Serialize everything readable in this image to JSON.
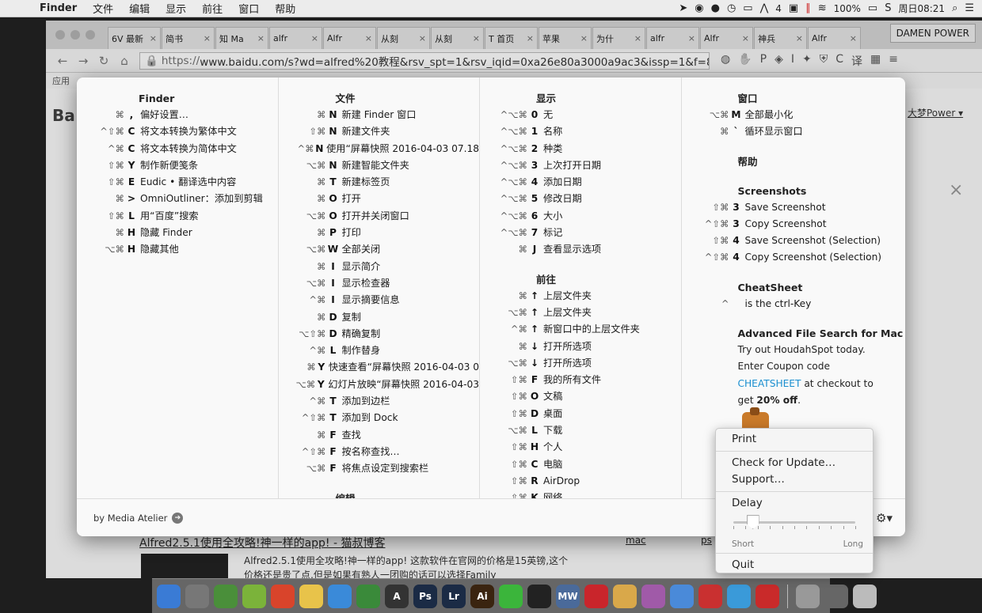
{
  "menubar": {
    "apple": "",
    "app_name": "Finder",
    "menus": [
      "文件",
      "编辑",
      "显示",
      "前往",
      "窗口",
      "帮助"
    ],
    "status": {
      "alfred_badge": "4",
      "battery": "100%",
      "datetime": "周日08:21"
    }
  },
  "browser": {
    "tabs": [
      {
        "label": "6V 最新"
      },
      {
        "label": "简书"
      },
      {
        "label": "知 Ma"
      },
      {
        "label": "alfr"
      },
      {
        "label": "Alfr"
      },
      {
        "label": "从刻"
      },
      {
        "label": "从刻"
      },
      {
        "label": "T 首页"
      },
      {
        "label": "苹果"
      },
      {
        "label": "为什"
      },
      {
        "label": "alfr"
      },
      {
        "label": "Alfr"
      },
      {
        "label": "神兵"
      },
      {
        "label": "Alfr"
      }
    ],
    "profile": "DAMEN POWER",
    "url_scheme": "https://",
    "url_rest": "www.baidu.com/s?wd=alfred%20教程&rsv_spt=1&rsv_iqid=0xa26e80a3000a9ac3&issp=1&f=8...",
    "bookmark_first": "应用",
    "logo": "Ba",
    "user": "大梦Power ▾",
    "result_title_em": "Alfred",
    "result_title_rest": "2.5.1使用全攻略!神一样的app! - 猫叔博客",
    "result_snippet_em": "Alfred",
    "result_snippet_rest": "2.5.1使用全攻略!神一样的app! 这款软件在官网的价格是15英镑,这个价格还是贵了点,但是如果有熟人一团购的话可以选择Family",
    "side_links": [
      "mac",
      "ps"
    ]
  },
  "cheatsheet": {
    "columns": [
      {
        "sections": [
          {
            "title": "Finder",
            "rows": [
              {
                "mods": "⌘",
                "key": ",",
                "label": "偏好设置…"
              },
              {
                "mods": "^⇧⌘",
                "key": "C",
                "label": "将文本转换为繁体中文"
              },
              {
                "mods": "^⌘",
                "key": "C",
                "label": "将文本转换为简体中文"
              },
              {
                "mods": "⇧⌘",
                "key": "Y",
                "label": "制作新便笺条"
              },
              {
                "mods": "⇧⌘",
                "key": "E",
                "label": "Eudic • 翻译选中内容"
              },
              {
                "mods": "⌘",
                "key": ">",
                "label": "OmniOutliner：添加到剪辑"
              },
              {
                "mods": "⇧⌘",
                "key": "L",
                "label": "用“百度”搜索"
              },
              {
                "mods": "⌘",
                "key": "H",
                "label": "隐藏 Finder"
              },
              {
                "mods": "⌥⌘",
                "key": "H",
                "label": "隐藏其他"
              }
            ]
          }
        ]
      },
      {
        "sections": [
          {
            "title": "文件",
            "rows": [
              {
                "mods": "⌘",
                "key": "N",
                "label": "新建 Finder 窗口"
              },
              {
                "mods": "⇧⌘",
                "key": "N",
                "label": "新建文件夹"
              },
              {
                "mods": "^⌘",
                "key": "N",
                "label": "使用“屏幕快照 2016-04-03 07.18"
              },
              {
                "mods": "⌥⌘",
                "key": "N",
                "label": "新建智能文件夹"
              },
              {
                "mods": "⌘",
                "key": "T",
                "label": "新建标签页"
              },
              {
                "mods": "⌘",
                "key": "O",
                "label": "打开"
              },
              {
                "mods": "⌥⌘",
                "key": "O",
                "label": "打开并关闭窗口"
              },
              {
                "mods": "⌘",
                "key": "P",
                "label": "打印"
              },
              {
                "mods": "⌥⌘",
                "key": "W",
                "label": "全部关闭"
              },
              {
                "mods": "⌘",
                "key": "I",
                "label": "显示简介"
              },
              {
                "mods": "⌥⌘",
                "key": "I",
                "label": "显示检查器"
              },
              {
                "mods": "^⌘",
                "key": "I",
                "label": "显示摘要信息"
              },
              {
                "mods": "⌘",
                "key": "D",
                "label": "复制"
              },
              {
                "mods": "⌥⇧⌘",
                "key": "D",
                "label": "精确复制"
              },
              {
                "mods": "^⌘",
                "key": "L",
                "label": "制作替身"
              },
              {
                "mods": "⌘",
                "key": "Y",
                "label": "快速查看“屏幕快照 2016-04-03 0"
              },
              {
                "mods": "⌥⌘",
                "key": "Y",
                "label": "幻灯片放映“屏幕快照 2016-04-03"
              },
              {
                "mods": "^⌘",
                "key": "T",
                "label": "添加到边栏"
              },
              {
                "mods": "^⇧⌘",
                "key": "T",
                "label": "添加到 Dock"
              },
              {
                "mods": "⌘",
                "key": "F",
                "label": "查找"
              },
              {
                "mods": "^⇧⌘",
                "key": "F",
                "label": "按名称查找…"
              },
              {
                "mods": "⌥⌘",
                "key": "F",
                "label": "将焦点设定到搜索栏"
              }
            ]
          },
          {
            "title": "编辑",
            "rows": []
          }
        ]
      },
      {
        "sections": [
          {
            "title": "显示",
            "rows": [
              {
                "mods": "^⌥⌘",
                "key": "0",
                "label": "无"
              },
              {
                "mods": "^⌥⌘",
                "key": "1",
                "label": "名称"
              },
              {
                "mods": "^⌥⌘",
                "key": "2",
                "label": "种类"
              },
              {
                "mods": "^⌥⌘",
                "key": "3",
                "label": "上次打开日期"
              },
              {
                "mods": "^⌥⌘",
                "key": "4",
                "label": "添加日期"
              },
              {
                "mods": "^⌥⌘",
                "key": "5",
                "label": "修改日期"
              },
              {
                "mods": "^⌥⌘",
                "key": "6",
                "label": "大小"
              },
              {
                "mods": "^⌥⌘",
                "key": "7",
                "label": "标记"
              },
              {
                "mods": "⌘",
                "key": "J",
                "label": "查看显示选项"
              }
            ]
          },
          {
            "title": "前往",
            "rows": [
              {
                "mods": "⌘",
                "key": "↑",
                "label": "上层文件夹"
              },
              {
                "mods": "⌥⌘",
                "key": "↑",
                "label": "上层文件夹"
              },
              {
                "mods": "^⌘",
                "key": "↑",
                "label": "新窗口中的上层文件夹"
              },
              {
                "mods": "⌘",
                "key": "↓",
                "label": "打开所选项"
              },
              {
                "mods": "⌥⌘",
                "key": "↓",
                "label": "打开所选项"
              },
              {
                "mods": "⇧⌘",
                "key": "F",
                "label": "我的所有文件"
              },
              {
                "mods": "⇧⌘",
                "key": "O",
                "label": "文稿"
              },
              {
                "mods": "⇧⌘",
                "key": "D",
                "label": "桌面"
              },
              {
                "mods": "⌥⌘",
                "key": "L",
                "label": "下载"
              },
              {
                "mods": "⇧⌘",
                "key": "H",
                "label": "个人"
              },
              {
                "mods": "⇧⌘",
                "key": "C",
                "label": "电脑"
              },
              {
                "mods": "⇧⌘",
                "key": "R",
                "label": "AirDrop"
              },
              {
                "mods": "⇧⌘",
                "key": "K",
                "label": "网络"
              }
            ]
          }
        ]
      },
      {
        "sections": [
          {
            "title": "窗口",
            "rows": [
              {
                "mods": "⌥⌘",
                "key": "M",
                "label": "全部最小化"
              },
              {
                "mods": "⌘",
                "key": "`",
                "label": "循环显示窗口"
              }
            ]
          },
          {
            "title": "帮助",
            "rows": []
          },
          {
            "title": "Screenshots",
            "rows": [
              {
                "mods": "⇧⌘",
                "key": "3",
                "label": "Save Screenshot"
              },
              {
                "mods": "^⇧⌘",
                "key": "3",
                "label": "Copy Screenshot"
              },
              {
                "mods": "⇧⌘",
                "key": "4",
                "label": "Save Screenshot (Selection)"
              },
              {
                "mods": "^⇧⌘",
                "key": "4",
                "label": "Copy Screenshot (Selection)"
              }
            ]
          },
          {
            "title": "CheatSheet",
            "rows": [
              {
                "mods": "^",
                "key": "",
                "label": "is the ctrl-Key"
              }
            ]
          }
        ]
      }
    ],
    "ad": {
      "title": "Advanced File Search for Mac",
      "line1": "Try out HoudahSpot today.",
      "line2": "Enter Coupon code",
      "coupon": "CHEATSHEET",
      "line3_rest": " at checkout to",
      "line4_pre": "get ",
      "line4_bold": "20% off",
      "line4_post": "."
    },
    "footer": "by Media Atelier",
    "icons": {
      "footer_arrow": "arrow-right-circle-icon",
      "gear": "gear-icon"
    }
  },
  "popup": {
    "print": "Print",
    "check_update": "Check for Update…",
    "support": "Support…",
    "delay_label": "Delay",
    "delay_value": 0.16,
    "delay_min_label": "Short",
    "delay_max_label": "Long",
    "quit": "Quit"
  },
  "dock": {
    "apps": [
      {
        "name": "finder",
        "color": "#3a7bd5",
        "glyph": ""
      },
      {
        "name": "launchpad",
        "color": "#777777",
        "glyph": ""
      },
      {
        "name": "chrome",
        "color": "#4a8f3a",
        "glyph": ""
      },
      {
        "name": "android",
        "color": "#7bb33a",
        "glyph": ""
      },
      {
        "name": "airmail",
        "color": "#d9442b",
        "glyph": ""
      },
      {
        "name": "notes",
        "color": "#e8c34a",
        "glyph": ""
      },
      {
        "name": "keynote",
        "color": "#3a8ad9",
        "glyph": ""
      },
      {
        "name": "evernote",
        "color": "#3a8a3a",
        "glyph": ""
      },
      {
        "name": "typeface",
        "color": "#333333",
        "glyph": "A"
      },
      {
        "name": "photoshop",
        "color": "#1b2b45",
        "glyph": "Ps"
      },
      {
        "name": "lightroom",
        "color": "#1b2b45",
        "glyph": "Lr"
      },
      {
        "name": "illustrator",
        "color": "#3a2410",
        "glyph": "Ai"
      },
      {
        "name": "wechat",
        "color": "#3bb53b",
        "glyph": ""
      },
      {
        "name": "qq",
        "color": "#222222",
        "glyph": ""
      },
      {
        "name": "mweb",
        "color": "#4a6a9a",
        "glyph": "MW"
      },
      {
        "name": "netease-music",
        "color": "#c9252b",
        "glyph": ""
      },
      {
        "name": "pencil",
        "color": "#d9a84a",
        "glyph": ""
      },
      {
        "name": "screen-recorder",
        "color": "#a05aa8",
        "glyph": ""
      },
      {
        "name": "preview",
        "color": "#4a8ad9",
        "glyph": ""
      },
      {
        "name": "parallels",
        "color": "#c93030",
        "glyph": ""
      },
      {
        "name": "telegram",
        "color": "#3a9ad9",
        "glyph": ""
      },
      {
        "name": "alfred",
        "color": "#c92a2a",
        "glyph": ""
      },
      {
        "name": "downloads",
        "color": "#999999",
        "glyph": ""
      },
      {
        "name": "printer",
        "color": "#666666",
        "glyph": ""
      },
      {
        "name": "trash",
        "color": "#bbbbbb",
        "glyph": ""
      }
    ]
  }
}
